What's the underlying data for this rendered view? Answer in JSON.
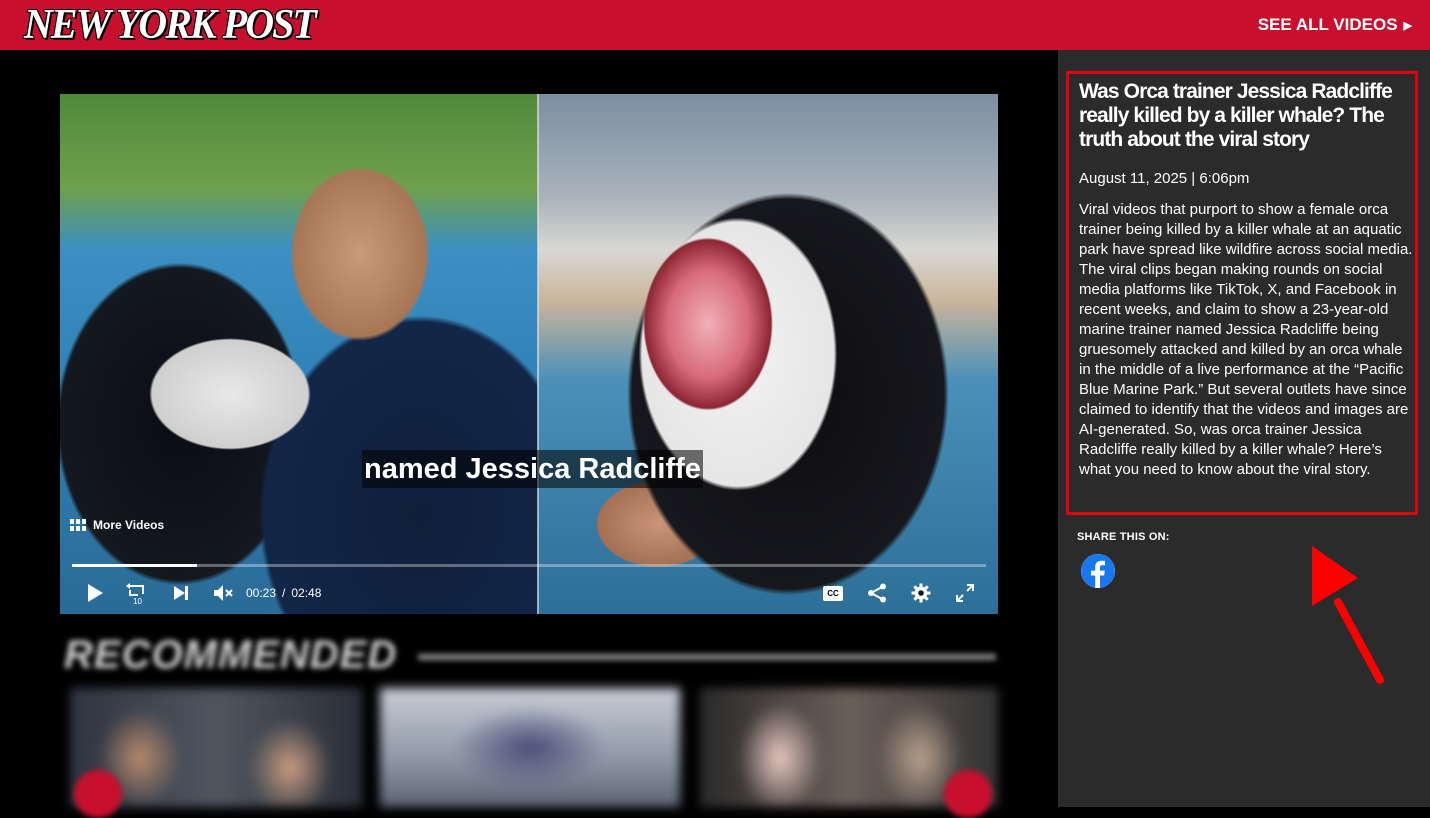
{
  "header": {
    "logo_text": "NEW YORK POST",
    "see_all_label": "SEE ALL VIDEOS"
  },
  "player": {
    "caption": "named Jessica Radcliffe",
    "more_videos_label": "More Videos",
    "current_time": "00:23",
    "time_separator": "/",
    "duration": "02:48",
    "progress_fraction": 0.137,
    "cc_label": "CC",
    "skip_seconds": "10"
  },
  "recommended": {
    "title": "RECOMMENDED"
  },
  "article": {
    "headline": "Was Orca trainer Jessica Radcliffe really killed by a killer whale? The truth about the viral story",
    "dateline": "August 11, 2025 | 6:06pm",
    "body": "Viral videos that purport to show a female orca trainer being killed by a killer whale at an aquatic park have spread like wildfire across social media. The viral clips began making rounds on social media platforms like TikTok, X, and Facebook in recent weeks, and claim to show a 23-year-old marine trainer named Jessica Radcliffe being gruesomely attacked and killed by an orca whale in the middle of a live performance at the “Pacific Blue Marine Park.” But several outlets have since claimed to identify that the videos and images are AI-generated. So, was orca trainer Jessica Radcliffe really killed by a killer whale? Here’s what you need to know about the viral story."
  },
  "share": {
    "label": "SHARE THIS ON:"
  },
  "colors": {
    "brand_red": "#c8102e",
    "highlight_red": "#e4000f",
    "sidebar_bg": "#2b2b2b",
    "facebook_blue": "#1877f2"
  },
  "icons": [
    "play-icon",
    "replay-10-icon",
    "skip-next-icon",
    "mute-icon",
    "cc-icon",
    "share-icon",
    "gear-icon",
    "fullscreen-icon",
    "grid-icon",
    "facebook-icon",
    "red-arrow"
  ]
}
